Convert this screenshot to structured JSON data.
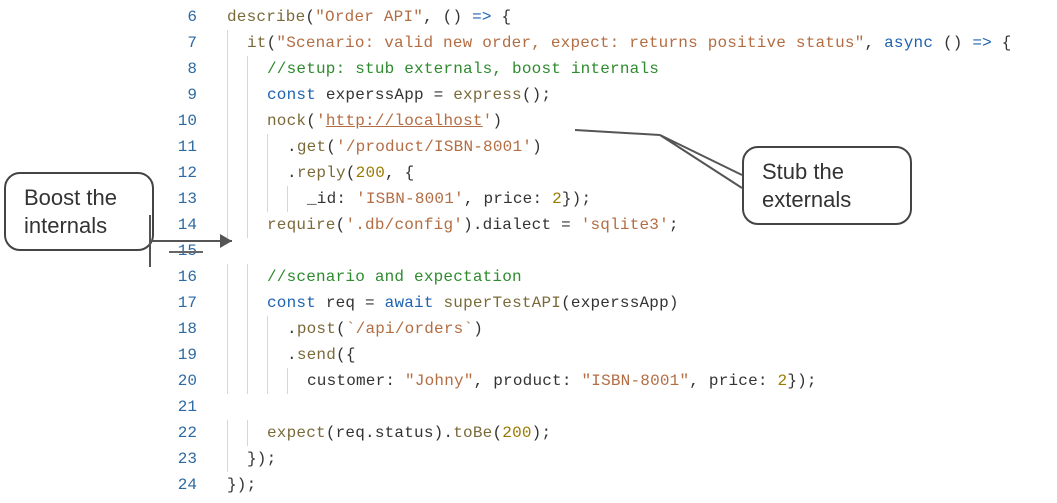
{
  "gutter_start": 6,
  "callouts": {
    "left": {
      "line1": "Boost the",
      "line2": "internals"
    },
    "right": {
      "line1": "Stub the",
      "line2": "externals"
    }
  },
  "lines": [
    {
      "n": 6,
      "indent": 0,
      "tokens": [
        {
          "c": "tok-fn",
          "t": "describe"
        },
        {
          "c": "tok-plain",
          "t": "("
        },
        {
          "c": "tok-str",
          "t": "\"Order API\""
        },
        {
          "c": "tok-plain",
          "t": ", () "
        },
        {
          "c": "tok-kw",
          "t": "=>"
        },
        {
          "c": "tok-plain",
          "t": " {"
        }
      ]
    },
    {
      "n": 7,
      "indent": 1,
      "tokens": [
        {
          "c": "tok-fn",
          "t": "it"
        },
        {
          "c": "tok-plain",
          "t": "("
        },
        {
          "c": "tok-str",
          "t": "\"Scenario: valid new order, expect: returns positive status\""
        },
        {
          "c": "tok-plain",
          "t": ", "
        },
        {
          "c": "tok-kw",
          "t": "async"
        },
        {
          "c": "tok-plain",
          "t": " () "
        },
        {
          "c": "tok-kw",
          "t": "=>"
        },
        {
          "c": "tok-plain",
          "t": " {"
        }
      ]
    },
    {
      "n": 8,
      "indent": 2,
      "tokens": [
        {
          "c": "tok-comment",
          "t": "//setup: stub externals, boost internals"
        }
      ]
    },
    {
      "n": 9,
      "indent": 2,
      "tokens": [
        {
          "c": "tok-kw",
          "t": "const"
        },
        {
          "c": "tok-plain",
          "t": " experssApp = "
        },
        {
          "c": "tok-fn",
          "t": "express"
        },
        {
          "c": "tok-plain",
          "t": "();"
        }
      ]
    },
    {
      "n": 10,
      "indent": 2,
      "tokens": [
        {
          "c": "tok-fn",
          "t": "nock"
        },
        {
          "c": "tok-plain",
          "t": "("
        },
        {
          "c": "tok-str",
          "t": "'"
        },
        {
          "c": "tok-str-url",
          "t": "http://localhost"
        },
        {
          "c": "tok-str",
          "t": "'"
        },
        {
          "c": "tok-plain",
          "t": ")"
        }
      ]
    },
    {
      "n": 11,
      "indent": 3,
      "tokens": [
        {
          "c": "tok-plain",
          "t": "."
        },
        {
          "c": "tok-fn",
          "t": "get"
        },
        {
          "c": "tok-plain",
          "t": "("
        },
        {
          "c": "tok-str",
          "t": "'/product/ISBN-8001'"
        },
        {
          "c": "tok-plain",
          "t": ")"
        }
      ]
    },
    {
      "n": 12,
      "indent": 3,
      "tokens": [
        {
          "c": "tok-plain",
          "t": "."
        },
        {
          "c": "tok-fn",
          "t": "reply"
        },
        {
          "c": "tok-plain",
          "t": "("
        },
        {
          "c": "tok-num",
          "t": "200"
        },
        {
          "c": "tok-plain",
          "t": ", {"
        }
      ]
    },
    {
      "n": 13,
      "indent": 4,
      "tokens": [
        {
          "c": "tok-plain",
          "t": "_id: "
        },
        {
          "c": "tok-str",
          "t": "'ISBN-8001'"
        },
        {
          "c": "tok-plain",
          "t": ", price: "
        },
        {
          "c": "tok-num",
          "t": "2"
        },
        {
          "c": "tok-plain",
          "t": "});"
        }
      ]
    },
    {
      "n": 14,
      "indent": 2,
      "tokens": [
        {
          "c": "tok-fn",
          "t": "require"
        },
        {
          "c": "tok-plain",
          "t": "("
        },
        {
          "c": "tok-str",
          "t": "'.db/config'"
        },
        {
          "c": "tok-plain",
          "t": ").dialect = "
        },
        {
          "c": "tok-str",
          "t": "'sqlite3'"
        },
        {
          "c": "tok-plain",
          "t": ";"
        }
      ]
    },
    {
      "n": 15,
      "indent": 0,
      "strike": true,
      "tokens": []
    },
    {
      "n": 16,
      "indent": 2,
      "tokens": [
        {
          "c": "tok-comment",
          "t": "//scenario and expectation"
        }
      ]
    },
    {
      "n": 17,
      "indent": 2,
      "tokens": [
        {
          "c": "tok-kw",
          "t": "const"
        },
        {
          "c": "tok-plain",
          "t": " req = "
        },
        {
          "c": "tok-kw",
          "t": "await"
        },
        {
          "c": "tok-plain",
          "t": " "
        },
        {
          "c": "tok-fn",
          "t": "superTestAPI"
        },
        {
          "c": "tok-plain",
          "t": "(experssApp)"
        }
      ]
    },
    {
      "n": 18,
      "indent": 3,
      "tokens": [
        {
          "c": "tok-plain",
          "t": "."
        },
        {
          "c": "tok-fn",
          "t": "post"
        },
        {
          "c": "tok-plain",
          "t": "("
        },
        {
          "c": "tok-str",
          "t": "`/api/orders`"
        },
        {
          "c": "tok-plain",
          "t": ")"
        }
      ]
    },
    {
      "n": 19,
      "indent": 3,
      "tokens": [
        {
          "c": "tok-plain",
          "t": "."
        },
        {
          "c": "tok-fn",
          "t": "send"
        },
        {
          "c": "tok-plain",
          "t": "({"
        }
      ]
    },
    {
      "n": 20,
      "indent": 4,
      "tokens": [
        {
          "c": "tok-plain",
          "t": "customer: "
        },
        {
          "c": "tok-str",
          "t": "\"Johny\""
        },
        {
          "c": "tok-plain",
          "t": ", product: "
        },
        {
          "c": "tok-str",
          "t": "\"ISBN-8001\""
        },
        {
          "c": "tok-plain",
          "t": ", price: "
        },
        {
          "c": "tok-num",
          "t": "2"
        },
        {
          "c": "tok-plain",
          "t": "});"
        }
      ]
    },
    {
      "n": 21,
      "indent": 0,
      "tokens": []
    },
    {
      "n": 22,
      "indent": 2,
      "tokens": [
        {
          "c": "tok-fn",
          "t": "expect"
        },
        {
          "c": "tok-plain",
          "t": "(req.status)."
        },
        {
          "c": "tok-fn",
          "t": "toBe"
        },
        {
          "c": "tok-plain",
          "t": "("
        },
        {
          "c": "tok-num",
          "t": "200"
        },
        {
          "c": "tok-plain",
          "t": ");"
        }
      ]
    },
    {
      "n": 23,
      "indent": 1,
      "tokens": [
        {
          "c": "tok-plain",
          "t": "});"
        }
      ]
    },
    {
      "n": 24,
      "indent": 0,
      "tokens": [
        {
          "c": "tok-plain",
          "t": "});"
        }
      ]
    }
  ]
}
